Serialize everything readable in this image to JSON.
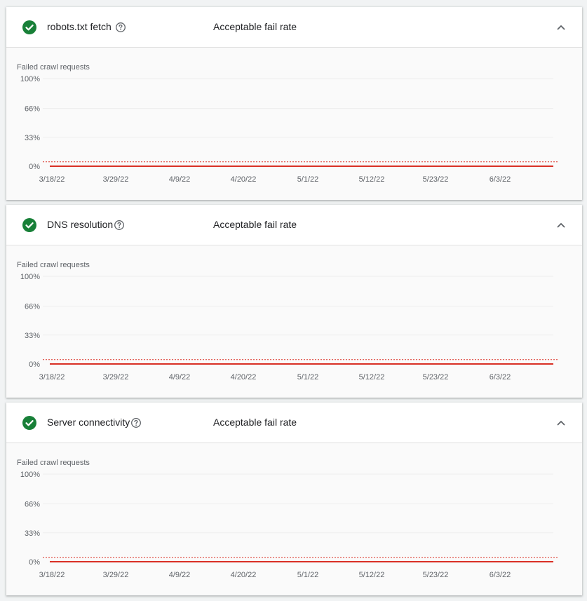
{
  "colors": {
    "success_green": "#188038",
    "fail_line_red": "#d93025",
    "threshold_red": "#d93025",
    "grid": "#eeeeee"
  },
  "cards": [
    {
      "title": "robots.txt fetch",
      "status": "Acceptable fail rate",
      "status_icon": "check-circle-icon",
      "help_icon": "help-circle-icon",
      "collapse_icon": "chevron-up-icon"
    },
    {
      "title": "DNS resolution",
      "status": "Acceptable fail rate",
      "status_icon": "check-circle-icon",
      "help_icon": "help-circle-icon",
      "collapse_icon": "chevron-up-icon"
    },
    {
      "title": "Server connectivity",
      "status": "Acceptable fail rate",
      "status_icon": "check-circle-icon",
      "help_icon": "help-circle-icon",
      "collapse_icon": "chevron-up-icon"
    }
  ],
  "chart_data": [
    {
      "type": "line",
      "title": "Failed crawl requests",
      "x_tick_labels": [
        "3/18/22",
        "3/29/22",
        "4/9/22",
        "4/20/22",
        "5/1/22",
        "5/12/22",
        "5/23/22",
        "6/3/22"
      ],
      "y_tick_labels": [
        "100%",
        "66%",
        "33%",
        "0%"
      ],
      "ylim": [
        0,
        100
      ],
      "threshold_value": 5,
      "series": [
        {
          "x_range": [
            "3/18/22",
            "6/13/22"
          ],
          "values": [
            0,
            0
          ]
        }
      ],
      "grid": true
    },
    {
      "type": "line",
      "title": "Failed crawl requests",
      "x_tick_labels": [
        "3/18/22",
        "3/29/22",
        "4/9/22",
        "4/20/22",
        "5/1/22",
        "5/12/22",
        "5/23/22",
        "6/3/22"
      ],
      "y_tick_labels": [
        "100%",
        "66%",
        "33%",
        "0%"
      ],
      "ylim": [
        0,
        100
      ],
      "threshold_value": 5,
      "series": [
        {
          "x_range": [
            "3/18/22",
            "6/13/22"
          ],
          "values": [
            0,
            0
          ]
        }
      ],
      "grid": true
    },
    {
      "type": "line",
      "title": "Failed crawl requests",
      "x_tick_labels": [
        "3/18/22",
        "3/29/22",
        "4/9/22",
        "4/20/22",
        "5/1/22",
        "5/12/22",
        "5/23/22",
        "6/3/22"
      ],
      "y_tick_labels": [
        "100%",
        "66%",
        "33%",
        "0%"
      ],
      "ylim": [
        0,
        100
      ],
      "threshold_value": 5,
      "series": [
        {
          "x_range": [
            "3/18/22",
            "6/13/22"
          ],
          "values": [
            0,
            0
          ]
        }
      ],
      "grid": true
    }
  ]
}
